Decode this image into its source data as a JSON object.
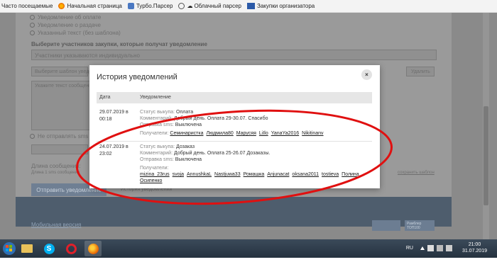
{
  "bookmarks": {
    "items": [
      {
        "label": "Часто посещаемые",
        "icon": "none"
      },
      {
        "label": "Начальная страница",
        "icon": "firefox-icon"
      },
      {
        "label": "Турбо.Парсер",
        "icon": "turbo-icon"
      },
      {
        "label": "Облачный парсер",
        "icon": "cloud-icon"
      },
      {
        "label": "Закупки организатора",
        "icon": "sp-icon"
      }
    ]
  },
  "background": {
    "option1": "Уведомление об оплате",
    "option2": "Уведомление о раздаче",
    "option3": "Указанный текст (без шаблона)",
    "participants_heading": "Выберите участников закупки, которые получат уведомление",
    "participants_select": "Участники указываются индивидуально",
    "template_placeholder": "Выберите шаблон уведомления",
    "delete_label": "Удалить",
    "text_placeholder": "Укажите текст сообщения",
    "sms_option": "Не отправлять sms",
    "message_length": "Длина сообщения:",
    "message_length2": "Длина 1 sms сообщения",
    "save_template": "сохранить шаблон",
    "send_button": "Отправить уведомление",
    "history_link": "История уведомлений",
    "mobile_link": "Мобильная версия",
    "badge_text": "Рамблер ТОП100"
  },
  "modal": {
    "title": "История уведомлений",
    "close_label": "×",
    "columns": {
      "date": "Дата",
      "notification": "Уведомление"
    },
    "rows": [
      {
        "date": "29.07.2019 в 00:18",
        "status_label": "Статус выкупа:",
        "status_value": "Оплата",
        "comment_label": "Комментарий:",
        "comment_value": "Добрый день. Оплата 29-30.07. Спасибо",
        "sms_label": "Отправка sms:",
        "sms_value": "Выключена",
        "recipients_label": "Получатели:",
        "recipients": [
          "Семинаристка",
          "Людмила80",
          "Марусяя",
          "LiIlo",
          "YanaYa2016",
          "Nikitinanv"
        ]
      },
      {
        "date": "24.07.2019 в 23:02",
        "status_label": "Статус выкупа:",
        "status_value": "Дозаказ",
        "comment_label": "Комментарий:",
        "comment_value": "Добрый день. Оплата 25-26.07 Дозаказы.",
        "sms_label": "Отправка sms:",
        "sms_value": "Выключена",
        "recipients_label": "Получатели:",
        "recipients": [
          "mizina_23rus",
          "svoja",
          "AnnushkaL",
          "Nastjuwa33",
          "Ромашка",
          "Anjunacat",
          "oksana2011",
          "tostieva",
          "Полина Осипенко"
        ]
      }
    ]
  },
  "taskbar": {
    "language": "RU",
    "time": "21:00",
    "date": "31.07.2019"
  },
  "colors": {
    "annotation": "#e01010",
    "taskbar": "#2f3d4c",
    "modal_header": "#e6e6e6"
  }
}
